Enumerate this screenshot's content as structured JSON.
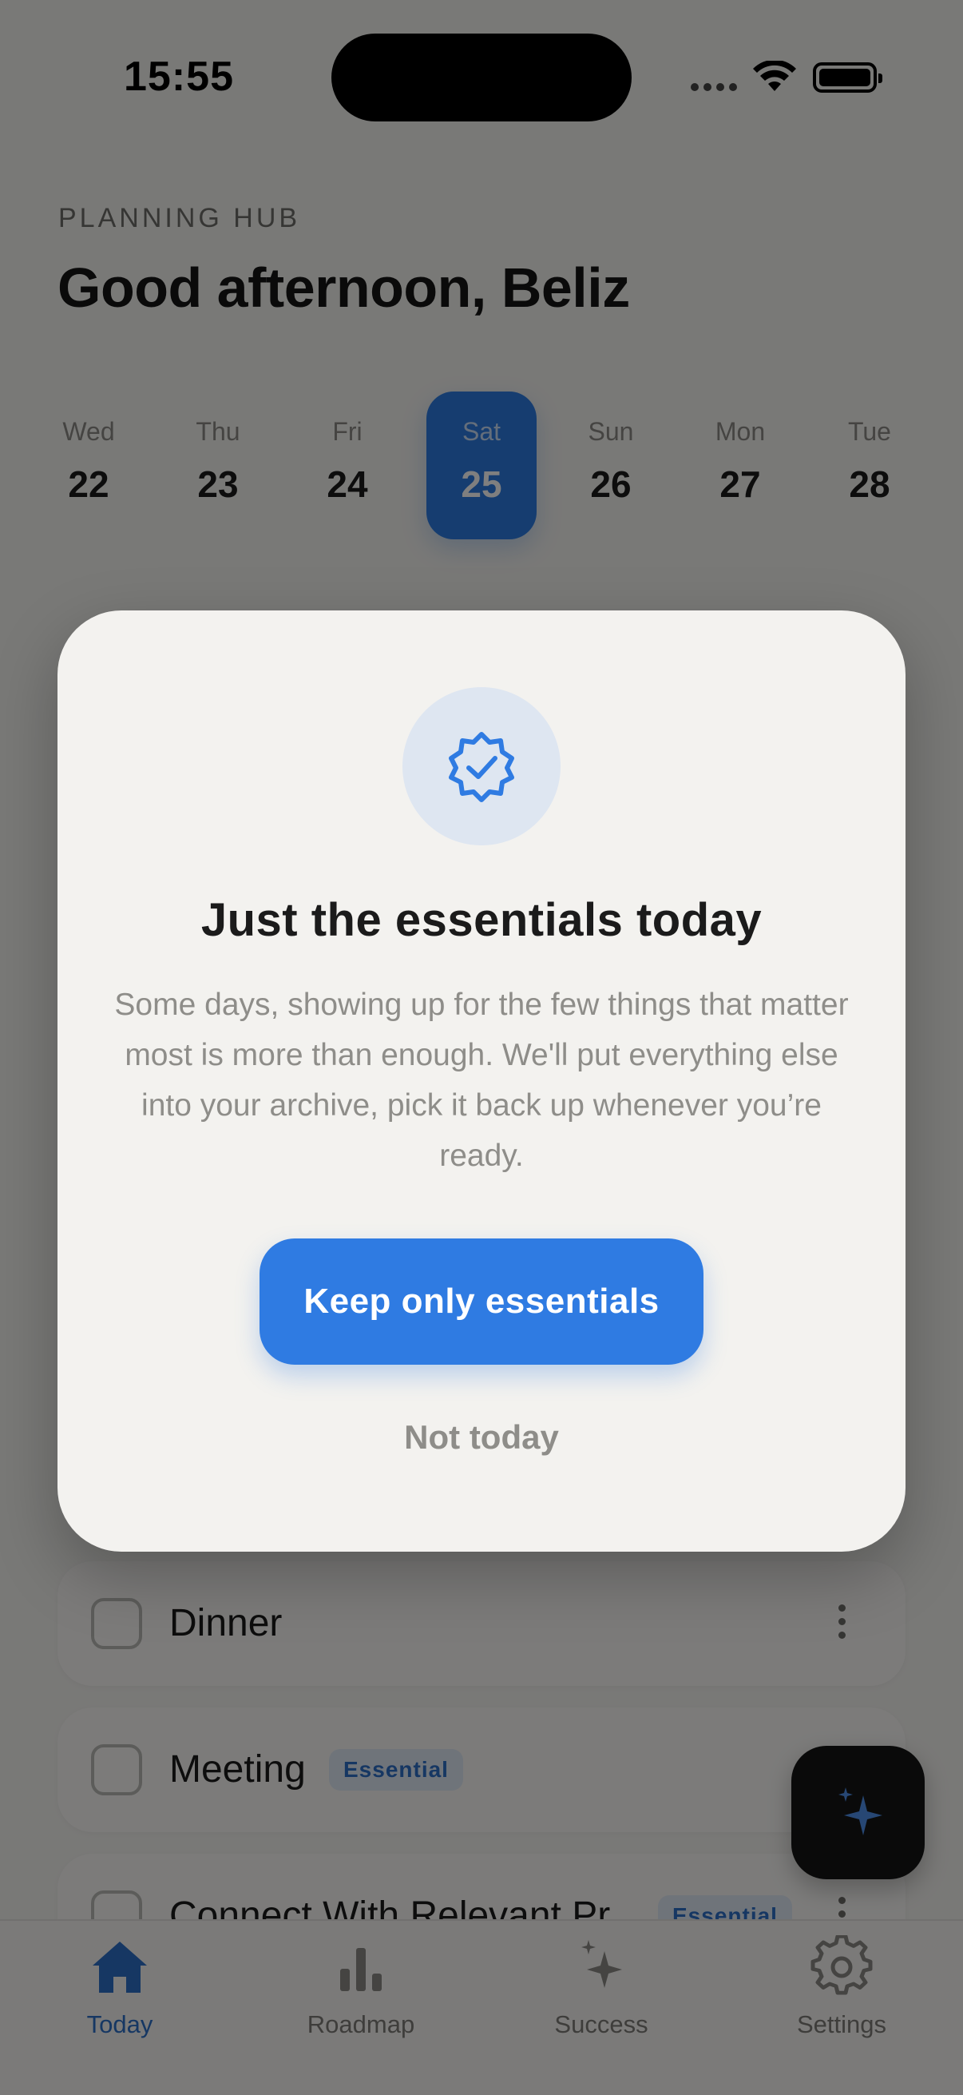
{
  "status_bar": {
    "time": "15:55"
  },
  "header": {
    "eyebrow": "PLANNING HUB",
    "greeting": "Good afternoon, Beliz"
  },
  "week": {
    "days": [
      {
        "name": "Wed",
        "num": "22"
      },
      {
        "name": "Thu",
        "num": "23"
      },
      {
        "name": "Fri",
        "num": "24"
      },
      {
        "name": "Sat",
        "num": "25"
      },
      {
        "name": "Sun",
        "num": "26"
      },
      {
        "name": "Mon",
        "num": "27"
      },
      {
        "name": "Tue",
        "num": "28"
      }
    ],
    "selected": "Sat"
  },
  "tasks": [
    {
      "name": "Dinner",
      "badge": ""
    },
    {
      "name": "Meeting",
      "badge": "Essential"
    },
    {
      "name": "Connect With Relevant Pr",
      "badge": "Essential"
    }
  ],
  "modal": {
    "icon": "verified-badge-icon",
    "title": "Just the essentials today",
    "body": "Some days, showing up for the few things that matter most is more than enough. We'll put everything else into your archive, pick it back up whenever you’re ready.",
    "primary_label": "Keep only essentials",
    "secondary_label": "Not today"
  },
  "tabbar": {
    "items": [
      {
        "label": "Today",
        "icon": "home-icon",
        "active": true
      },
      {
        "label": "Roadmap",
        "icon": "bar-chart-icon",
        "active": false
      },
      {
        "label": "Success",
        "icon": "sparkle-icon",
        "active": false
      },
      {
        "label": "Settings",
        "icon": "gear-icon",
        "active": false
      }
    ]
  },
  "colors": {
    "accent": "#2f7be2",
    "badge_bg": "#dfe8f5",
    "scrim": "rgba(0,0,0,0.5)"
  }
}
